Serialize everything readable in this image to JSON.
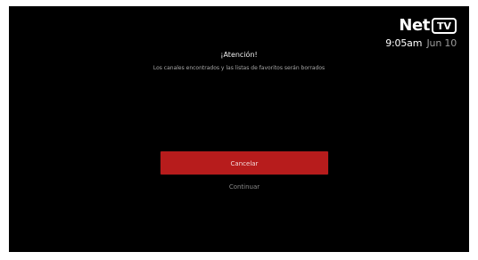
{
  "brand": {
    "logo_text": "Net",
    "logo_badge": "TV"
  },
  "clock": {
    "time": "9:05am",
    "date": "Jun 10"
  },
  "dialog": {
    "title": "¡Atención!",
    "message": "Los canales encontrados y las listas de favoritos serán borrados",
    "buttons": {
      "cancel": "Cancelar",
      "continue": "Continuar"
    }
  },
  "colors": {
    "background": "#000000",
    "accent": "#b71c1c",
    "text_primary": "#ffffff",
    "text_secondary": "#9c9c9c"
  }
}
